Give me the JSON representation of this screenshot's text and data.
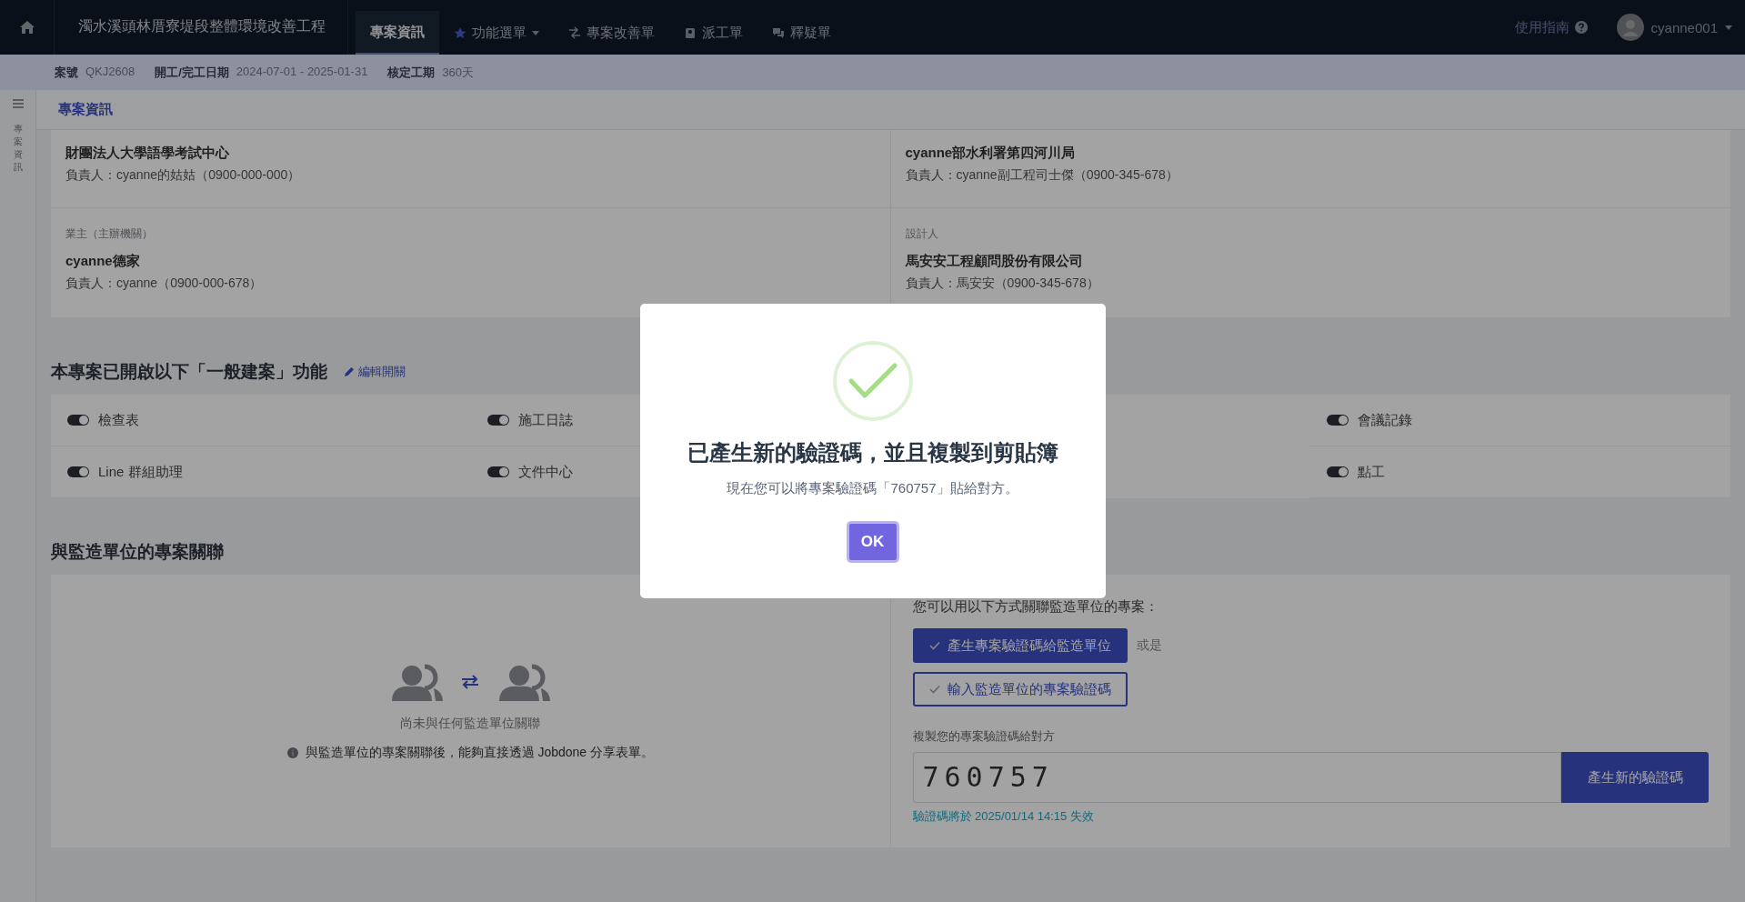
{
  "topbar": {
    "project_title": "濁水溪頭林厝寮堤段整體環境改善工程",
    "tabs": [
      {
        "label": "專案資訊",
        "kind": "plain",
        "selected": true
      },
      {
        "label": "功能選單",
        "kind": "menu",
        "selected": false
      },
      {
        "label": "專案改善單",
        "kind": "changes",
        "selected": false
      },
      {
        "label": "派工單",
        "kind": "dispatch",
        "selected": false
      },
      {
        "label": "釋疑單",
        "kind": "questions",
        "selected": false
      }
    ],
    "guide": "使用指南",
    "user": "cyanne001"
  },
  "info_bar": [
    {
      "label": "案號",
      "value": "QKJ2608"
    },
    {
      "label": "開工/完工日期",
      "value": "2024-07-01 - 2025-01-31"
    },
    {
      "label": "核定工期",
      "value": "360天"
    }
  ],
  "sidebar": {
    "label": "專案資訊"
  },
  "breadcrumb": "專案資訊",
  "parties": [
    {
      "name": "財團法人大學語學考試中心",
      "contact": "負責人：cyanne的姑姑（0900-000-000）"
    },
    {
      "name": "cyanne部水利署第四河川局",
      "contact": "負責人：cyanne副工程司士傑（0900-345-678）"
    },
    {
      "label": "業主（主辦機關）",
      "name": "cyanne德家",
      "contact": "負責人：cyanne（0900-000-678）"
    },
    {
      "label": "設計人",
      "name": "馬安安工程顧問股份有限公司",
      "contact": "負責人：馬安安（0900-345-678）"
    }
  ],
  "features": {
    "title": "本專案已開啟以下「一般建案」功能",
    "edit_link": "編輯開關",
    "items": [
      {
        "label": "檢查表",
        "on": true
      },
      {
        "label": "施工日誌",
        "on": true
      },
      {
        "label": "會議記錄",
        "on": true
      },
      {
        "label": "Line 群組助理",
        "on": true
      },
      {
        "label": "文件中心",
        "on": true
      },
      {
        "label": "點工",
        "on": true
      }
    ]
  },
  "supervisor": {
    "title": "與監造單位的專案關聯",
    "empty_text": "尚未與任何監造單位關聯",
    "hint": "與監造單位的專案關聯後，能夠直接透過 Jobdone 分享表單。",
    "intro": "您可以用以下方式關聯監造單位的專案：",
    "options": [
      {
        "label": "產生專案驗證碼給監造單位",
        "selected": true
      },
      {
        "label": "輸入監造單位的專案驗證碼",
        "selected": false
      }
    ],
    "or_text": "或是",
    "code_label": "複製您的專案驗證碼給對方",
    "code": "760757",
    "new_code_button": "產生新的驗證碼",
    "expiry": "驗證碼將於 2025/01/14 14:15 失效"
  },
  "dialog": {
    "title": "已產生新的驗證碼，並且複製到剪貼簿",
    "message": "現在您可以將專案驗證碼「760757」貼給對方。",
    "button": "OK"
  }
}
